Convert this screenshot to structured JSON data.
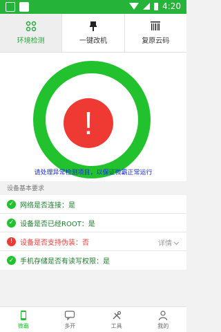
{
  "status_bar": {
    "time": "4:20"
  },
  "tabs": [
    {
      "label": "环境检测",
      "icon": "env-check-icon",
      "active": true
    },
    {
      "label": "一键改机",
      "icon": "brush-icon",
      "active": false
    },
    {
      "label": "复原云码",
      "icon": "barcode-icon",
      "active": false
    }
  ],
  "status": {
    "alert_symbol": "!",
    "message": "请处理异常检测项目，以保证微霸正常运行",
    "ring_color": "#21c22e",
    "alert_color": "#ef3a34"
  },
  "section": {
    "title": "设备基本要求"
  },
  "checks": [
    {
      "text": "网络是否连接：是",
      "ok": true
    },
    {
      "text": "设备是否已经ROOT：是",
      "ok": true
    },
    {
      "text": "设备是否支持伪装：否",
      "ok": false,
      "detail": "详情"
    },
    {
      "text": "手机存储是否有读写权限：是",
      "ok": true
    }
  ],
  "bottom_nav": [
    {
      "label": "微霸",
      "icon": "phone-icon",
      "active": true
    },
    {
      "label": "多开",
      "icon": "chat-icon",
      "active": false
    },
    {
      "label": "工具",
      "icon": "tools-icon",
      "active": false
    },
    {
      "label": "我的",
      "icon": "user-icon",
      "active": false
    }
  ]
}
